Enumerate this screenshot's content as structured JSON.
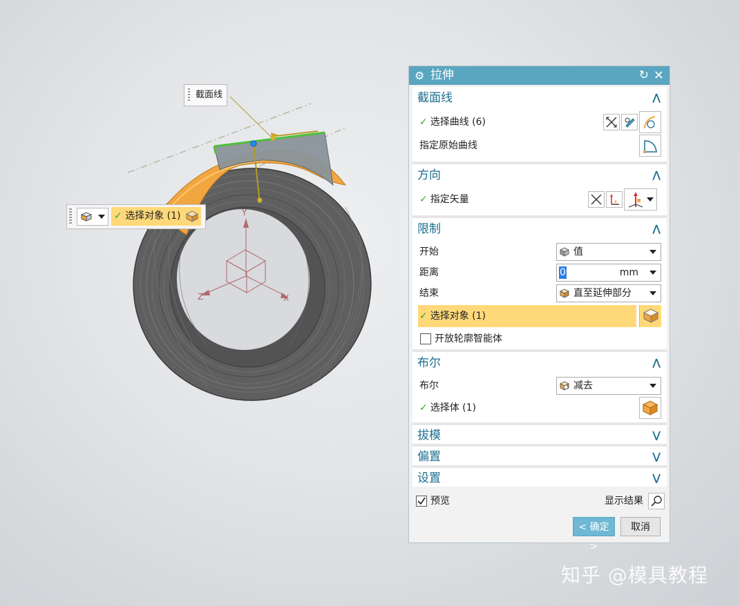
{
  "viewport": {
    "tooltip_label": "截面线",
    "floatbar": {
      "selection_text": "选择对象 (1)"
    },
    "axes": {
      "x": "X",
      "y": "Y",
      "z": "Z"
    }
  },
  "dialog": {
    "title": "拉伸",
    "sections": {
      "section_curve": {
        "title": "截面线",
        "select_curve": "选择曲线 (6)",
        "specify_origin_curve": "指定原始曲线"
      },
      "direction": {
        "title": "方向",
        "specify_vector": "指定矢量"
      },
      "limits": {
        "title": "限制",
        "start_label": "开始",
        "start_value": "值",
        "distance_label": "距离",
        "distance_value": "0",
        "distance_unit": "mm",
        "end_label": "结束",
        "end_value": "直至延伸部分",
        "select_object": "选择对象 (1)",
        "open_profile": "开放轮廓智能体"
      },
      "boolean": {
        "title": "布尔",
        "boolean_label": "布尔",
        "boolean_value": "减去",
        "select_body": "选择体 (1)"
      },
      "draft": {
        "title": "拔模"
      },
      "offset": {
        "title": "偏置"
      },
      "settings": {
        "title": "设置"
      }
    },
    "preview_label": "预览",
    "preview_checked": true,
    "open_profile_checked": false,
    "show_result_label": "显示结果",
    "ok_label": "< 确定 >",
    "cancel_label": "取消"
  },
  "watermark": "知乎 @模具教程",
  "colors": {
    "title_bar": "#5aa5c0",
    "section_title": "#1c6f8f",
    "selection_highlight": "#ffd979",
    "check_green": "#3aa52c",
    "body_orange": "#f2a640"
  }
}
